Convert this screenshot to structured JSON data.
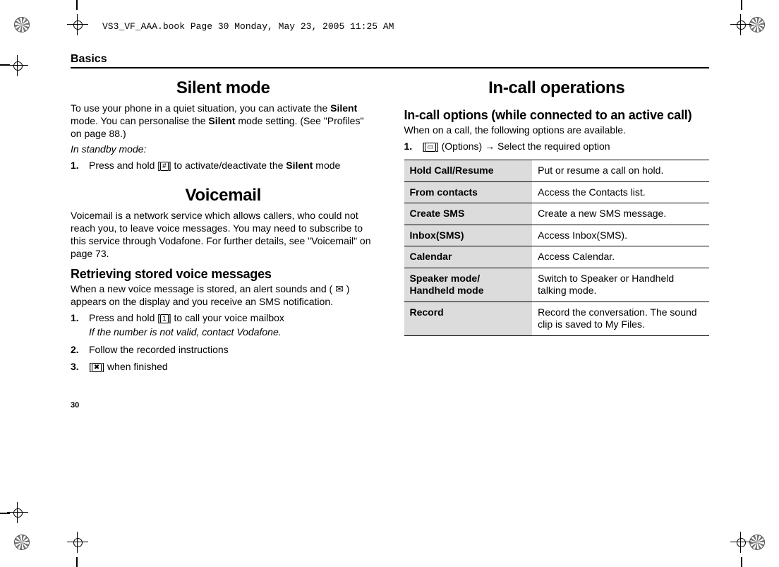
{
  "header_file": "VS3_VF_AAA.book  Page 30  Monday, May 23, 2005  11:25 AM",
  "running_head": "Basics",
  "page_number": "30",
  "left": {
    "silent": {
      "title": "Silent mode",
      "intro_before_b1": "To use your phone in a quiet situation, you can activate the ",
      "b1": "Silent",
      "intro_mid": " mode. You can personalise the ",
      "b2": "Silent",
      "intro_after": " mode setting. (See \"Profiles\" on page 88.)",
      "standby": "In standby mode:",
      "step1_pre": "Press and hold [",
      "step1_glyph": "#",
      "step1_mid": "] to activate/deactivate the ",
      "step1_bold": "Silent",
      "step1_post": " mode"
    },
    "voicemail": {
      "title": "Voicemail",
      "intro": "Voicemail is a network service which allows callers, who could not reach you, to leave voice messages. You may need to subscribe to this service through Vodafone. For further details, see \"Voicemail\" on page 73.",
      "retrieve_h": "Retrieving stored voice messages",
      "retrieve_p_pre": "When a new voice message is stored, an alert sounds and ( ",
      "retrieve_icon": "✉",
      "retrieve_p_post": " ) appears on the display and you receive an SMS notification.",
      "s1_pre": "Press and hold [",
      "s1_glyph": "1",
      "s1_post": "] to call your voice mailbox",
      "s1_note": "If the number is not valid, contact Vodafone.",
      "s2": "Follow the recorded instructions",
      "s3_pre": "[",
      "s3_glyph": "✖",
      "s3_post": "] when finished"
    }
  },
  "right": {
    "incall_title": "In-call operations",
    "opts_h": "In-call options (while connected to an active call)",
    "opts_p": "When on a call, the following options are available.",
    "step1_pre": "[",
    "step1_glyph": "▭",
    "step1_mid": "] (Options) ",
    "step1_arrow": "→",
    "step1_post": " Select the required option",
    "table": [
      {
        "k": "Hold Call/Resume",
        "v": "Put or resume a call on hold."
      },
      {
        "k": "From contacts",
        "v": "Access the Contacts list."
      },
      {
        "k": "Create SMS",
        "v": "Create a new SMS message."
      },
      {
        "k": "Inbox(SMS)",
        "v": "Access Inbox(SMS)."
      },
      {
        "k": "Calendar",
        "v": "Access Calendar."
      },
      {
        "k": "Speaker mode/ Handheld mode",
        "v": "Switch to Speaker or Handheld talking mode."
      },
      {
        "k": "Record",
        "v": "Record the conversation. The sound clip is saved to My Files."
      }
    ]
  }
}
